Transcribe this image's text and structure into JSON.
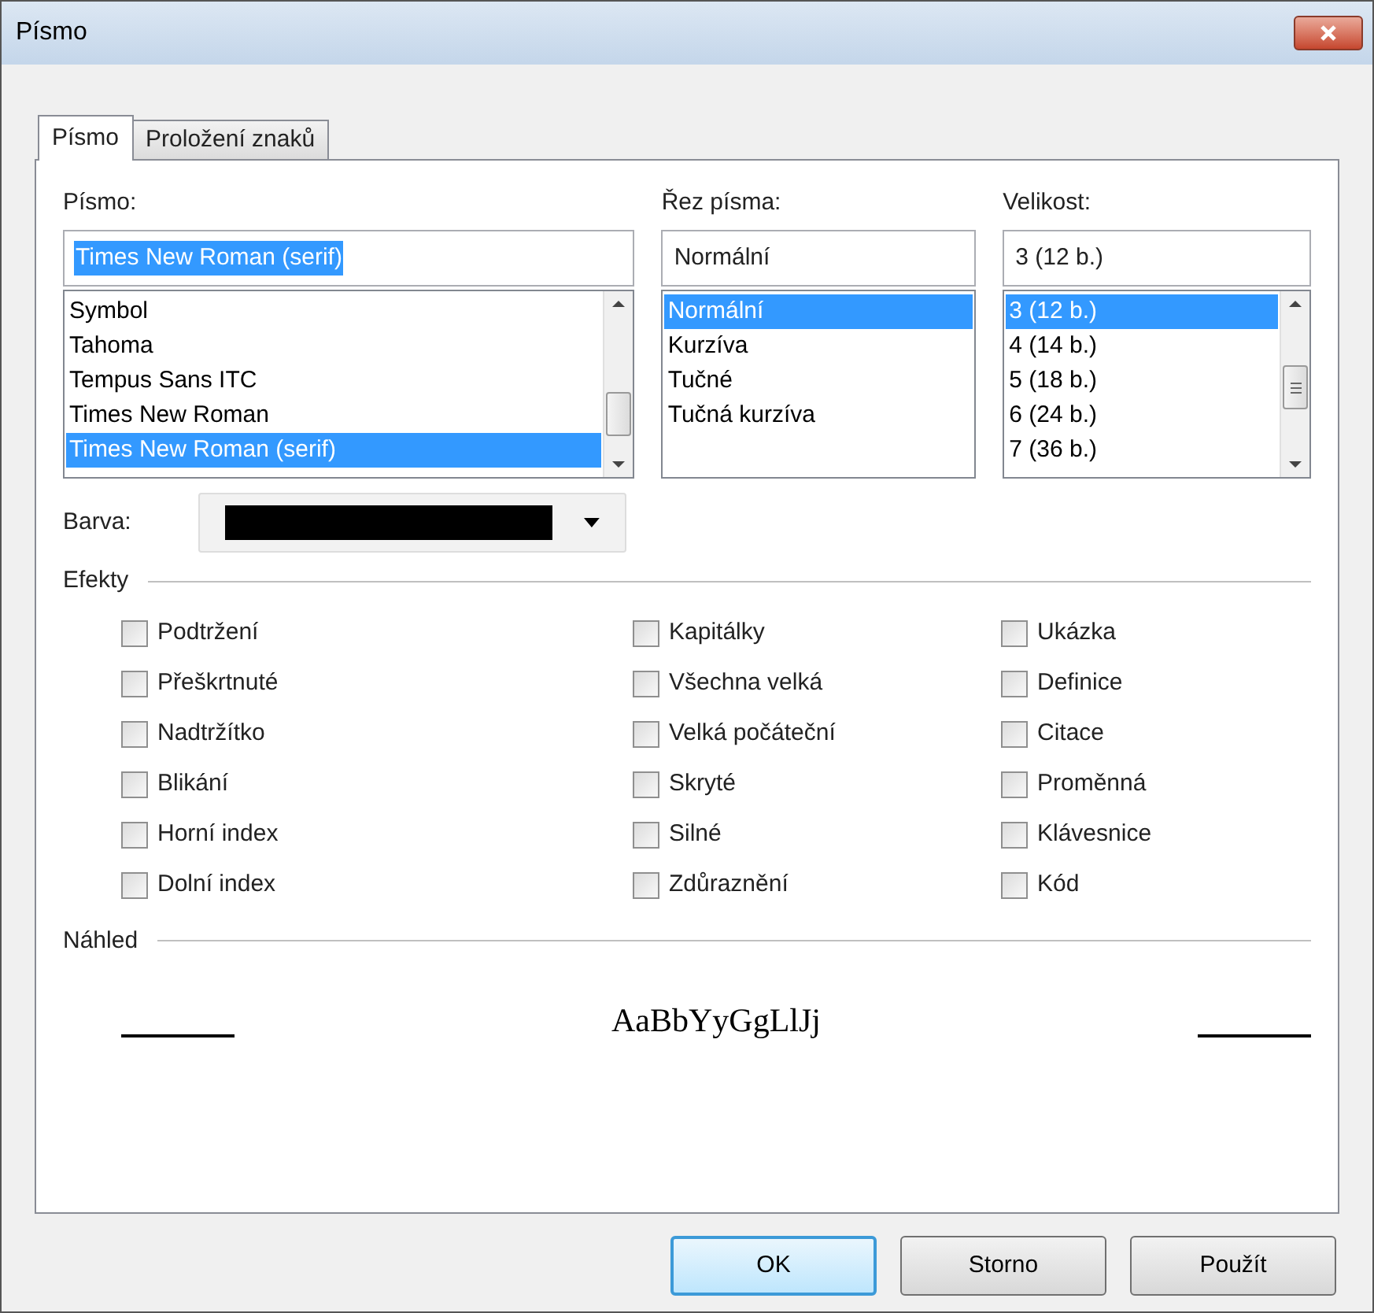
{
  "window": {
    "title": "Písmo"
  },
  "tabs": [
    {
      "label": "Písmo",
      "selected": true
    },
    {
      "label": "Proložení znaků",
      "selected": false
    }
  ],
  "font": {
    "label": "Písmo:",
    "value": "Times New Roman (serif)",
    "items": [
      {
        "label": "Symbol",
        "selected": false
      },
      {
        "label": "Tahoma",
        "selected": false
      },
      {
        "label": "Tempus Sans ITC",
        "selected": false
      },
      {
        "label": "Times New Roman",
        "selected": false
      },
      {
        "label": "Times New Roman (serif)",
        "selected": true
      }
    ]
  },
  "style": {
    "label": "Řez písma:",
    "value": "Normální",
    "items": [
      {
        "label": "Normální",
        "selected": true
      },
      {
        "label": "Kurzíva",
        "selected": false
      },
      {
        "label": "Tučné",
        "selected": false
      },
      {
        "label": "Tučná kurzíva",
        "selected": false
      }
    ]
  },
  "size": {
    "label": "Velikost:",
    "value": "3 (12 b.)",
    "items": [
      {
        "label": "3 (12 b.)",
        "selected": true
      },
      {
        "label": "4 (14 b.)",
        "selected": false
      },
      {
        "label": "5 (18 b.)",
        "selected": false
      },
      {
        "label": "6 (24 b.)",
        "selected": false
      },
      {
        "label": "7 (36 b.)",
        "selected": false
      }
    ]
  },
  "color": {
    "label": "Barva:",
    "color": "#000000"
  },
  "effects": {
    "label": "Efekty",
    "items": [
      {
        "label": "Podtržení",
        "checked": false
      },
      {
        "label": "Přeškrtnuté",
        "checked": false
      },
      {
        "label": "Nadtržítko",
        "checked": false
      },
      {
        "label": "Blikání",
        "checked": false
      },
      {
        "label": "Horní index",
        "checked": false
      },
      {
        "label": "Dolní index",
        "checked": false
      },
      {
        "label": "Kapitálky",
        "checked": false
      },
      {
        "label": "Všechna velká",
        "checked": false
      },
      {
        "label": "Velká počáteční",
        "checked": false
      },
      {
        "label": "Skryté",
        "checked": false
      },
      {
        "label": "Silné",
        "checked": false
      },
      {
        "label": "Zdůraznění",
        "checked": false
      },
      {
        "label": "Ukázka",
        "checked": false
      },
      {
        "label": "Definice",
        "checked": false
      },
      {
        "label": "Citace",
        "checked": false
      },
      {
        "label": "Proměnná",
        "checked": false
      },
      {
        "label": "Klávesnice",
        "checked": false
      },
      {
        "label": "Kód",
        "checked": false
      }
    ]
  },
  "preview": {
    "label": "Náhled",
    "sample": "AaBbYyGgLlJj"
  },
  "buttons": [
    {
      "label": "OK",
      "default": true
    },
    {
      "label": "Storno",
      "default": false
    },
    {
      "label": "Použít",
      "default": false
    }
  ]
}
